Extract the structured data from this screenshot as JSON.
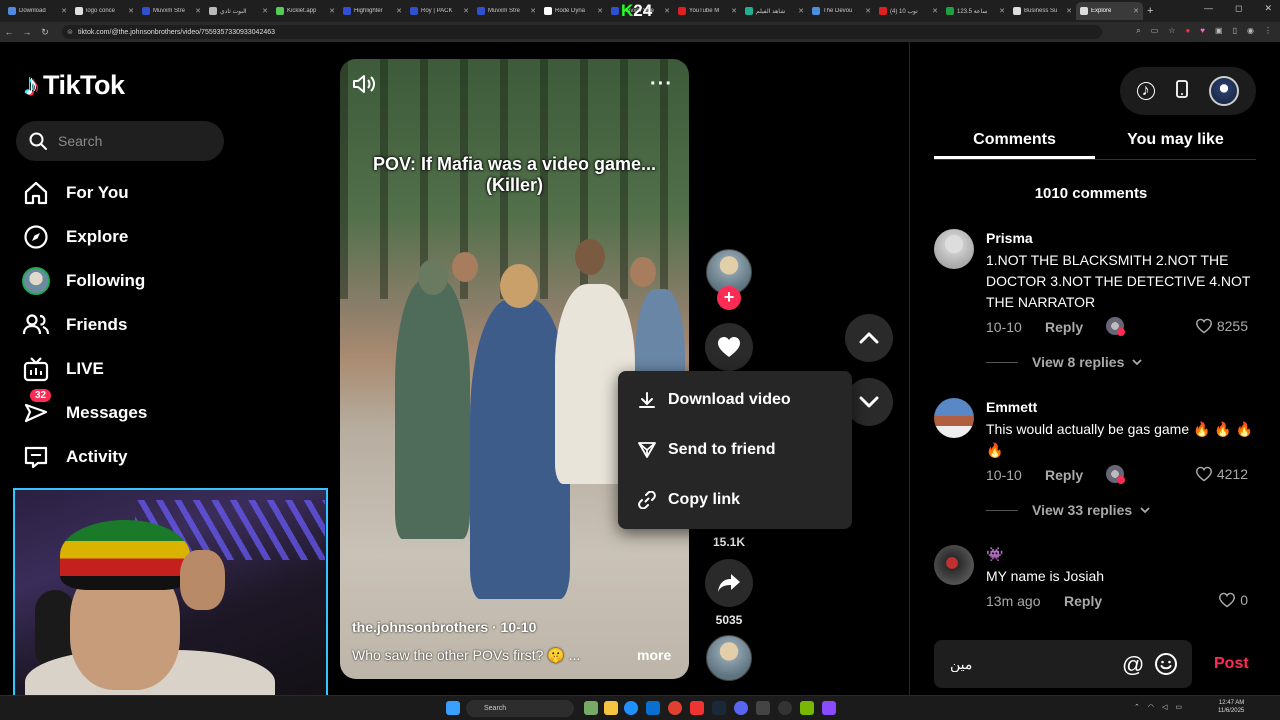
{
  "browser": {
    "tabs": [
      {
        "label": "Download",
        "color": "#4f8be0"
      },
      {
        "label": "logo conce",
        "color": "#e0e0e0"
      },
      {
        "label": "Muvxm Stre",
        "color": "#3050d0"
      },
      {
        "label": "البوت ثادي",
        "color": "#bbbbbb"
      },
      {
        "label": "Kicklet.app",
        "color": "#55cc55"
      },
      {
        "label": "Highlighter",
        "color": "#3050d0"
      },
      {
        "label": "Roy | PACK",
        "color": "#3050d0"
      },
      {
        "label": "Muvxm Stre",
        "color": "#3050d0"
      },
      {
        "label": "Rode Dyna",
        "color": "#ffffff"
      },
      {
        "label": "Muvxm Stre",
        "color": "#3050d0"
      },
      {
        "label": "YouTube M",
        "color": "#e02020"
      },
      {
        "label": "شاهد الفيلم",
        "color": "#20b090"
      },
      {
        "label": "The Devou",
        "color": "#4a90e0"
      },
      {
        "label": "توب 10 (4)",
        "color": "#e02020"
      },
      {
        "label": "123.5 ساعة",
        "color": "#20a040"
      },
      {
        "label": "Business Su",
        "color": "#dddddd"
      },
      {
        "label": "Explore",
        "color": "#dddddd",
        "active": true
      }
    ],
    "new_tab": "+",
    "url": "tiktok.com/@the.johnsonbrothers/video/7559357330933042463",
    "window_controls": [
      "—",
      "◻",
      "✕"
    ]
  },
  "overlay_k24": {
    "k": "K",
    "num": "24"
  },
  "sidebar": {
    "logo_text": "TikTok",
    "search_placeholder": "Search",
    "items": [
      {
        "label": "For You",
        "icon": "home-icon"
      },
      {
        "label": "Explore",
        "icon": "compass-icon"
      },
      {
        "label": "Following",
        "icon": "following-avatar"
      },
      {
        "label": "Friends",
        "icon": "friends-icon"
      },
      {
        "label": "LIVE",
        "icon": "live-icon"
      },
      {
        "label": "Messages",
        "icon": "messages-icon",
        "badge": "32"
      },
      {
        "label": "Activity",
        "icon": "activity-icon"
      }
    ]
  },
  "video": {
    "caption": "POV: If Mafia was a video game...\n(Killer)",
    "author": "the.johnsonbrothers · 10-10",
    "description": "Who saw the other POVs first? 🤫 ...",
    "more": "more"
  },
  "actions": {
    "comments_count": "15.1K",
    "shares_count": "5035"
  },
  "context_menu": {
    "items": [
      {
        "label": "Download video",
        "icon": "download-icon"
      },
      {
        "label": "Send to friend",
        "icon": "send-icon"
      },
      {
        "label": "Copy link",
        "icon": "link-icon"
      }
    ]
  },
  "panel": {
    "tabs": [
      {
        "label": "Comments",
        "active": true
      },
      {
        "label": "You may like",
        "active": false
      }
    ],
    "comment_count": "1010 comments",
    "comments": [
      {
        "name": "Prisma",
        "text": "1.NOT THE BLACKSMITH 2.NOT THE DOCTOR 3.NOT THE DETECTIVE 4.NOT THE NARRATOR",
        "date": "10-10",
        "reply": "Reply",
        "likes": "8255",
        "view_replies": "View 8 replies"
      },
      {
        "name": "Emmett",
        "text": "This would actually be gas game 🔥 🔥 🔥 🔥",
        "date": "10-10",
        "reply": "Reply",
        "likes": "4212",
        "view_replies": "View 33 replies"
      },
      {
        "name": "👾",
        "text": "MY name is Josiah",
        "date": "13m ago",
        "reply": "Reply",
        "likes": "0"
      }
    ],
    "input_value": "مين",
    "at_symbol": "@",
    "post_label": "Post"
  },
  "taskbar": {
    "search_placeholder": "Search",
    "time": "12:47 AM",
    "date": "11/6/2025"
  }
}
